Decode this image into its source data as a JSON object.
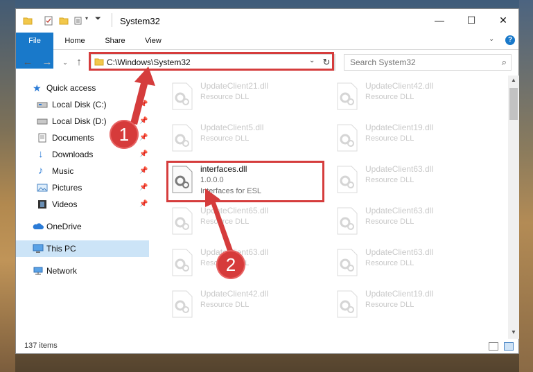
{
  "window": {
    "title": "System32"
  },
  "ribbon": {
    "tabs": [
      "File",
      "Home",
      "Share",
      "View"
    ]
  },
  "address": {
    "path": "C:\\Windows\\System32"
  },
  "search": {
    "placeholder": "Search System32"
  },
  "nav": {
    "quick_access": "Quick access",
    "items": [
      {
        "label": "Local Disk (C:)",
        "icon": "drive-icon"
      },
      {
        "label": "Local Disk (D:)",
        "icon": "drive-icon"
      },
      {
        "label": "Documents",
        "icon": "documents-icon"
      },
      {
        "label": "Downloads",
        "icon": "downloads-icon"
      },
      {
        "label": "Music",
        "icon": "music-icon"
      },
      {
        "label": "Pictures",
        "icon": "pictures-icon"
      },
      {
        "label": "Videos",
        "icon": "videos-icon"
      }
    ],
    "onedrive": "OneDrive",
    "this_pc": "This PC",
    "network": "Network"
  },
  "files": [
    {
      "name": "UpdateClient21.dll",
      "line2": "Resource DLL",
      "line3": ""
    },
    {
      "name": "UpdateClient42.dll",
      "line2": "Resource DLL",
      "line3": ""
    },
    {
      "name": "UpdateClient5.dll",
      "line2": "Resource DLL",
      "line3": ""
    },
    {
      "name": "UpdateClient19.dll",
      "line2": "Resource DLL",
      "line3": ""
    },
    {
      "name": "interfaces.dll",
      "line2": "1.0.0.0",
      "line3": "Interfaces for ESL"
    },
    {
      "name": "UpdateClient63.dll",
      "line2": "Resource DLL",
      "line3": ""
    },
    {
      "name": "UpdateClient65.dll",
      "line2": "Resource DLL",
      "line3": ""
    },
    {
      "name": "UpdateClient63.dll",
      "line2": "Resource DLL",
      "line3": ""
    },
    {
      "name": "UpdateClient63.dll",
      "line2": "Resource DLL",
      "line3": ""
    },
    {
      "name": "UpdateClient63.dll",
      "line2": "Resource DLL",
      "line3": ""
    },
    {
      "name": "UpdateClient42.dll",
      "line2": "Resource DLL",
      "line3": ""
    },
    {
      "name": "UpdateClient19.dll",
      "line2": "Resource DLL",
      "line3": ""
    }
  ],
  "status": {
    "item_count": "137 items"
  },
  "annotations": {
    "step1": "1",
    "step2": "2"
  },
  "colors": {
    "accent": "#1979ca",
    "highlight_red": "#d53c3c",
    "selected_nav": "#cce4f7"
  }
}
